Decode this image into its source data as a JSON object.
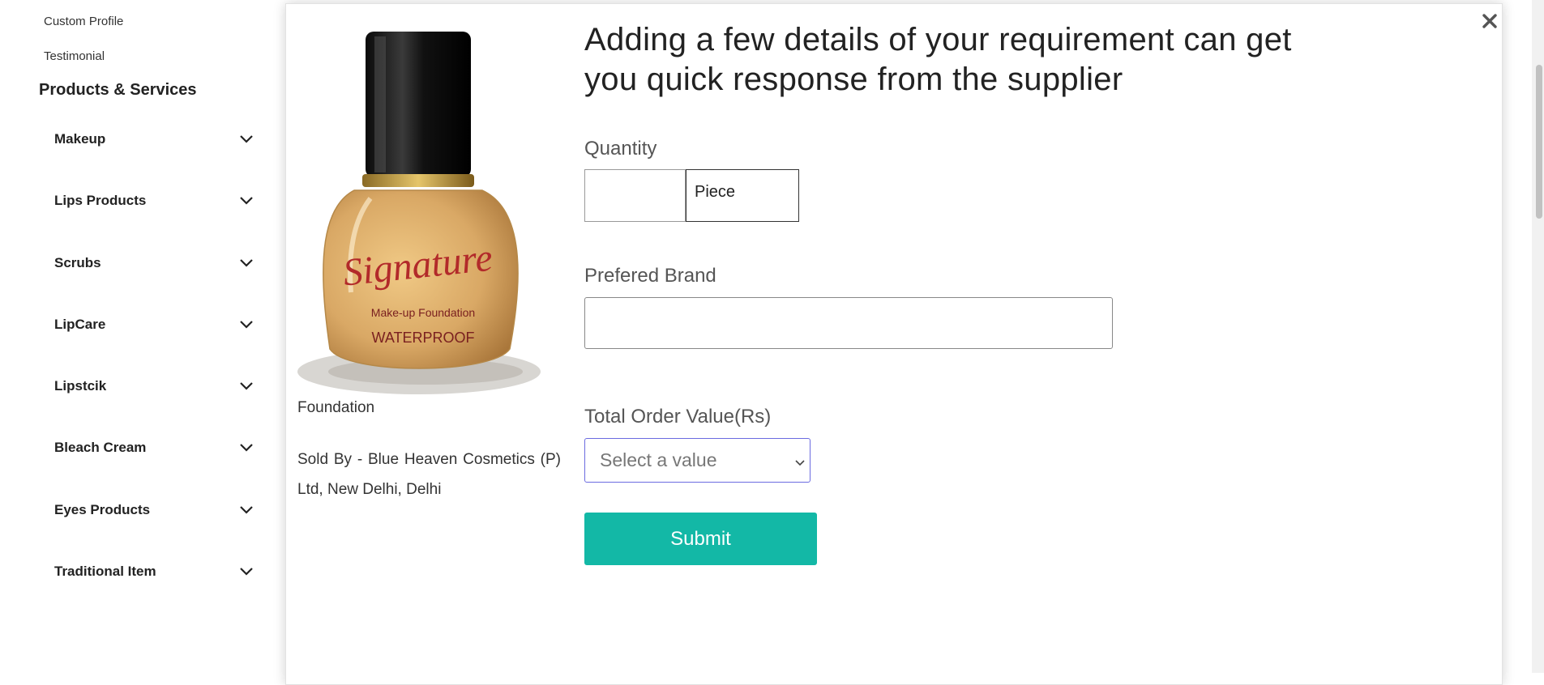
{
  "sidebar": {
    "links": [
      "Custom Profile",
      "Testimonial"
    ],
    "heading": "Products & Services",
    "categories": [
      {
        "label": "Makeup"
      },
      {
        "label": "Lips Products"
      },
      {
        "label": "Scrubs"
      },
      {
        "label": "LipCare"
      },
      {
        "label": "Lipstcik"
      },
      {
        "label": "Bleach Cream"
      },
      {
        "label": "Eyes Products"
      },
      {
        "label": "Traditional Item"
      }
    ]
  },
  "modal": {
    "close_icon": "close-icon",
    "product": {
      "name": "Foundation",
      "seller": "Sold By - Blue Heaven Cosmetics (P) Ltd, New Delhi, Delhi",
      "image_text": {
        "brand": "Signature",
        "line1": "Make-up Foundation",
        "line2": "WATERPROOF"
      }
    },
    "title": "Adding a few details of your requirement can get you quick response from the supplier",
    "quantity": {
      "label": "Quantity",
      "value": "",
      "unit": "Piece"
    },
    "brand": {
      "label": "Prefered Brand",
      "value": ""
    },
    "order_value": {
      "label": "Total Order Value(Rs)",
      "placeholder": "Select a value"
    },
    "submit_label": "Submit"
  },
  "colors": {
    "accent": "#13b8a6",
    "select_border": "#6b6be0",
    "text": "#222222"
  }
}
